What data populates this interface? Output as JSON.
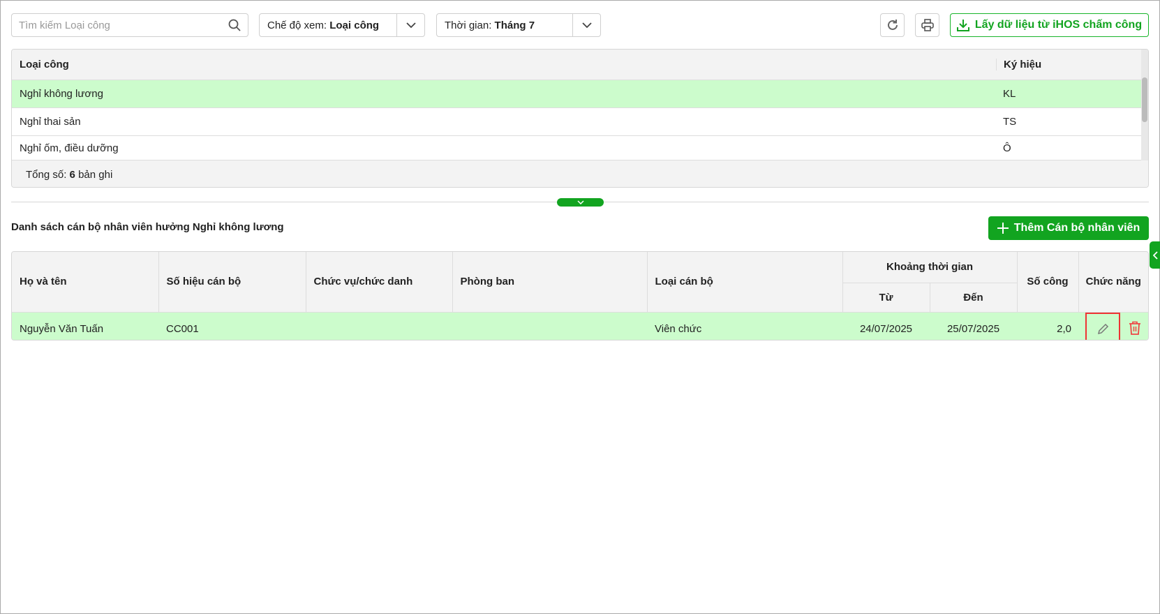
{
  "toolbar": {
    "search_placeholder": "Tìm kiếm Loại công",
    "view_mode_label": "Chế độ xem:",
    "view_mode_value": "Loại công",
    "time_label": "Thời gian:",
    "time_value": "Tháng 7",
    "fetch_button": "Lấy dữ liệu từ iHOS chấm công"
  },
  "types_table": {
    "headers": [
      "Loại công",
      "Ký hiệu"
    ],
    "rows": [
      {
        "name": "Nghỉ không lương",
        "code": "KL"
      },
      {
        "name": "Nghỉ thai sản",
        "code": "TS"
      },
      {
        "name": "Nghỉ ốm, điều dưỡng",
        "code": "Ô"
      }
    ],
    "footer_prefix": "Tổng số:",
    "footer_count": "6",
    "footer_suffix": "bản ghi"
  },
  "section": {
    "title": "Danh sách cán bộ nhân viên hưởng Nghỉ không lương",
    "add_button": "Thêm Cán bộ nhân viên"
  },
  "staff_table": {
    "headers": {
      "name": "Họ và tên",
      "id": "Số hiệu cán bộ",
      "position": "Chức vụ/chức danh",
      "department": "Phòng ban",
      "type": "Loại cán bộ",
      "period": "Khoảng thời gian",
      "from": "Từ",
      "to": "Đến",
      "days": "Số công",
      "actions": "Chức năng"
    },
    "rows": [
      {
        "name": "Nguyễn Văn Tuấn",
        "id": "CC001",
        "position": "",
        "department": "",
        "type": "Viên chức",
        "from": "24/07/2025",
        "to": "25/07/2025",
        "days": "2,0"
      }
    ]
  }
}
